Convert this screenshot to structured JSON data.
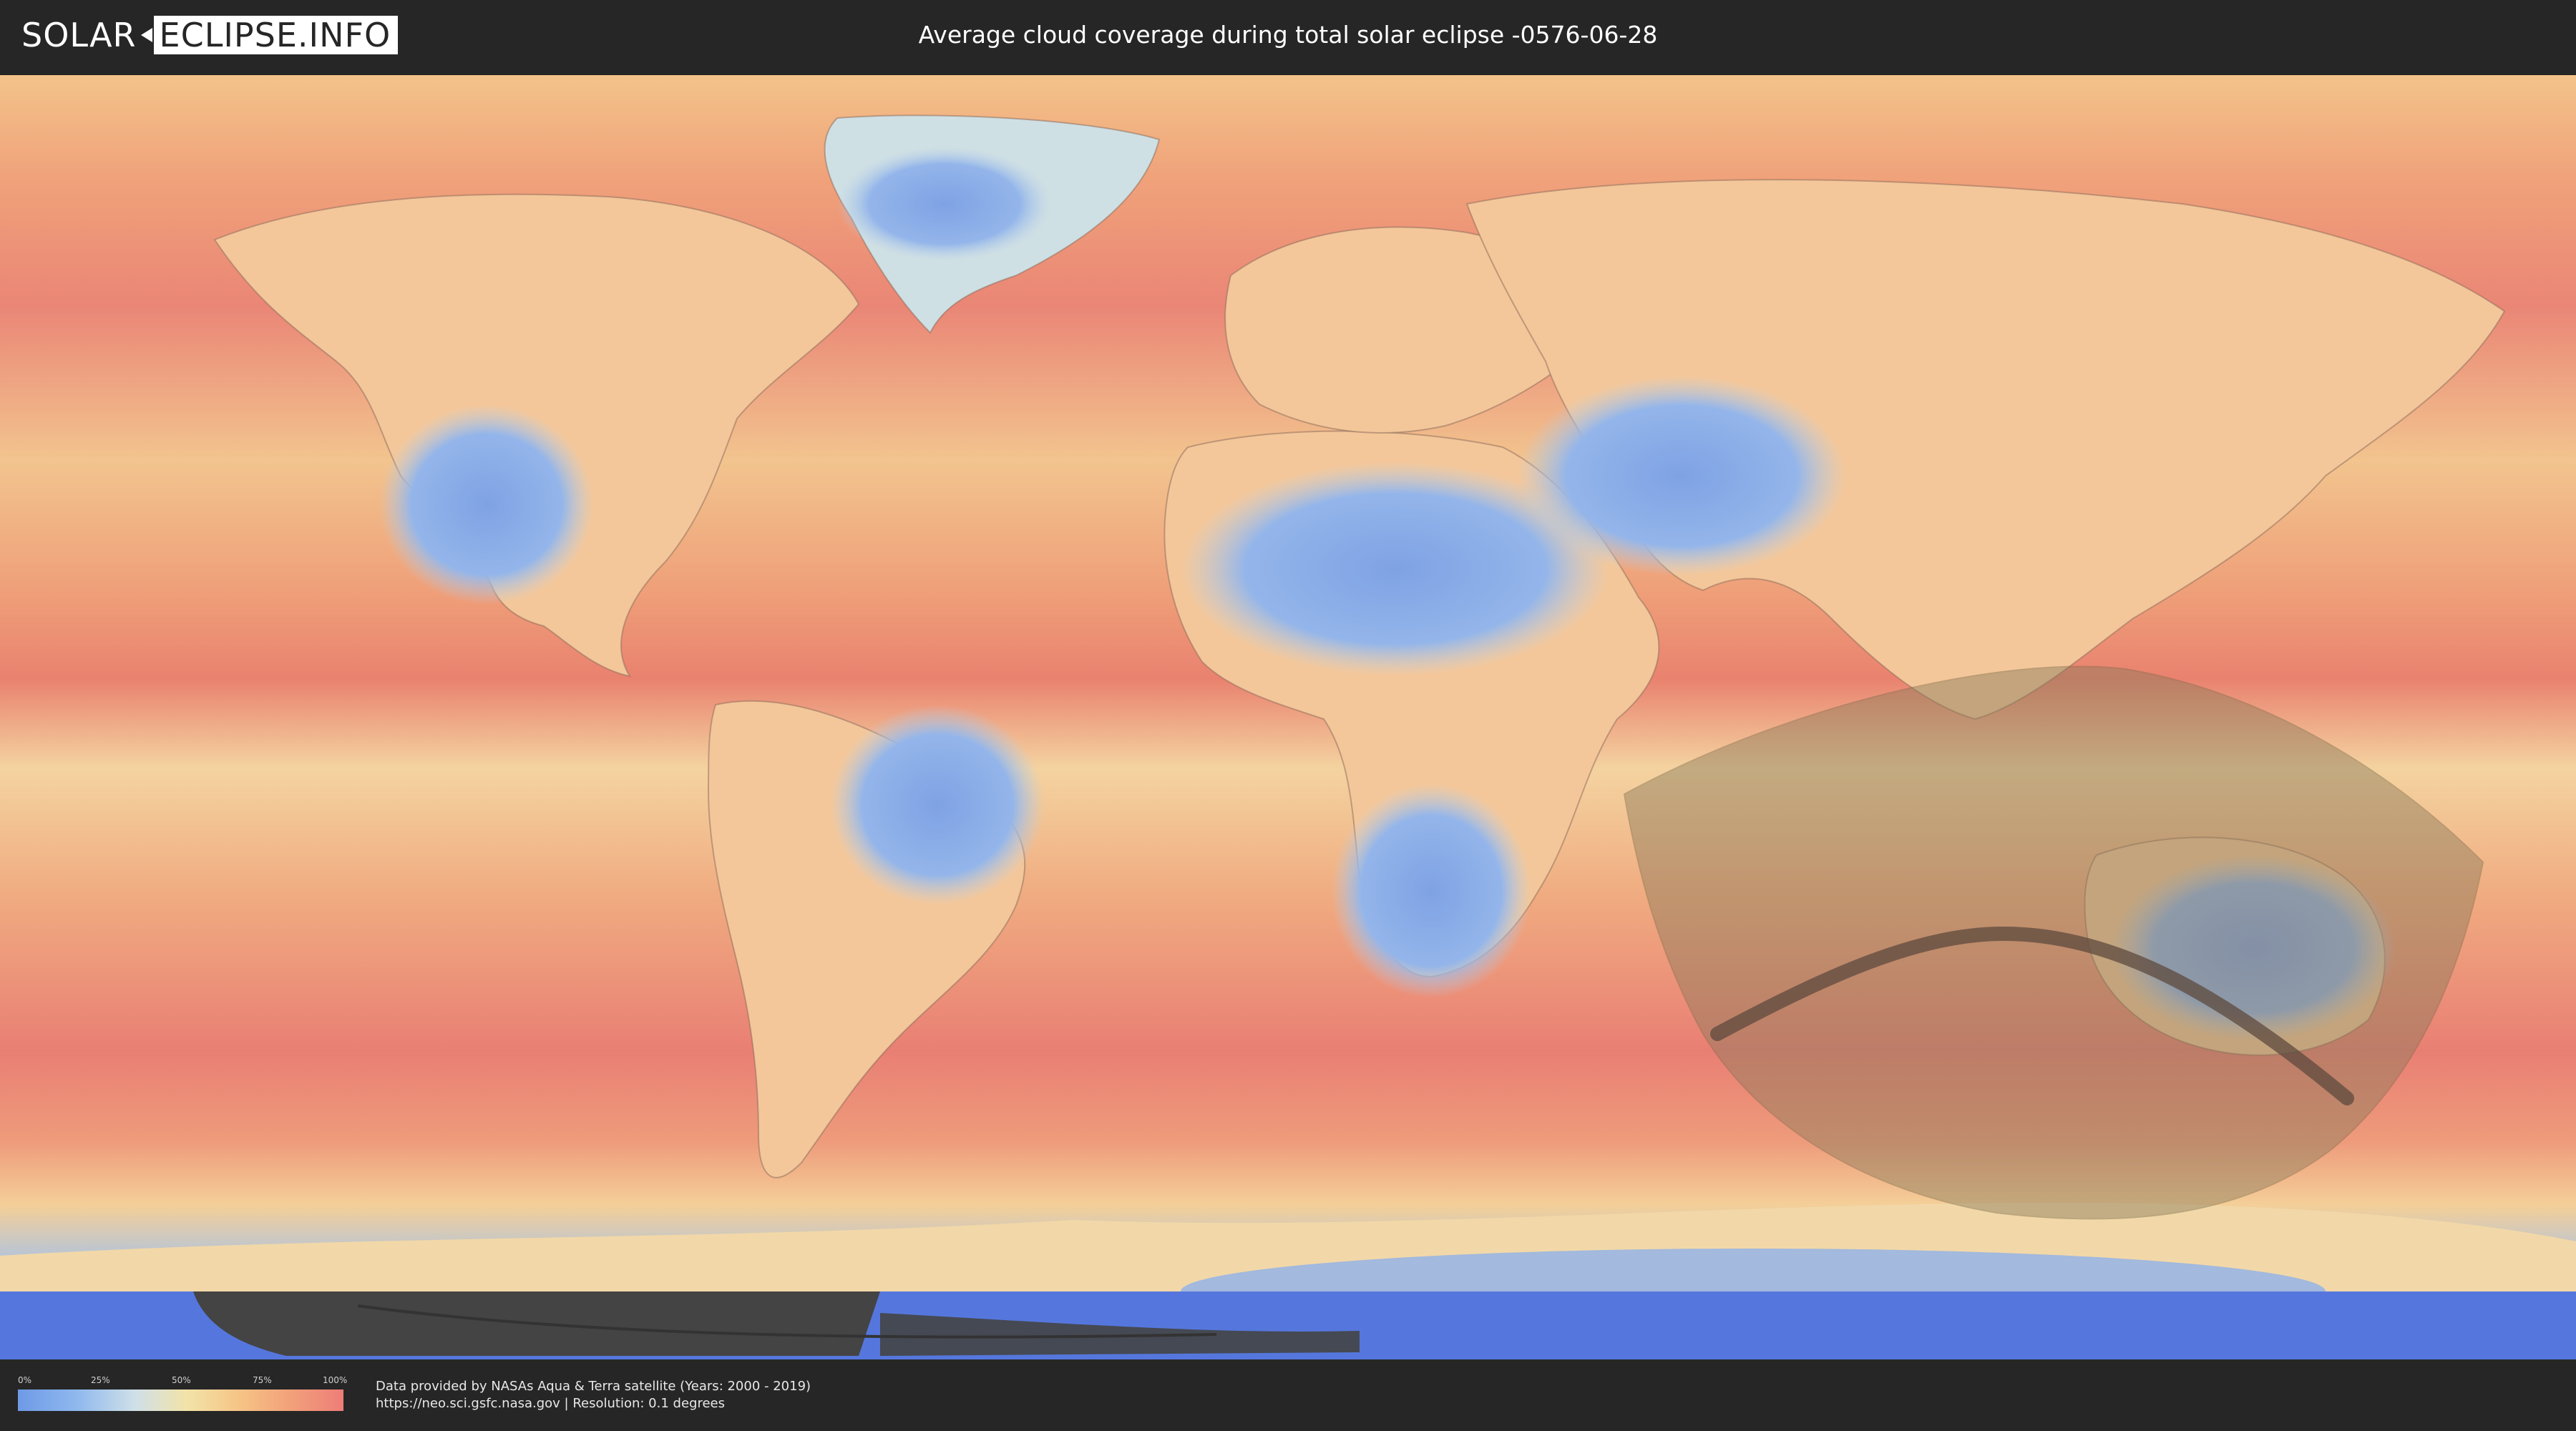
{
  "header": {
    "logo_left": "SOLAR",
    "logo_right": "ECLIPSE.INFO",
    "title": "Average cloud coverage during total solar eclipse -0576-06-28"
  },
  "map": {
    "description_icons": [
      "cloud-coverage-map",
      "eclipse-visibility-zone",
      "totality-path"
    ],
    "colors": {
      "low_cloud": "#6e9ae6",
      "mid_cloud": "#f2e3a8",
      "high_cloud": "#ee7d78",
      "eclipse_zone": "#8a7a5a",
      "totality_path": "#5e4a3e",
      "night_shadow": "#444444",
      "antarctic_ice": "#5577dd"
    }
  },
  "legend": {
    "ticks": [
      "0%",
      "25%",
      "50%",
      "75%",
      "100%"
    ]
  },
  "footer": {
    "credit_line1": "Data provided by NASAs Aqua & Terra satellite (Years: 2000 - 2019)",
    "credit_line2": "https://neo.sci.gsfc.nasa.gov | Resolution: 0.1 degrees"
  }
}
